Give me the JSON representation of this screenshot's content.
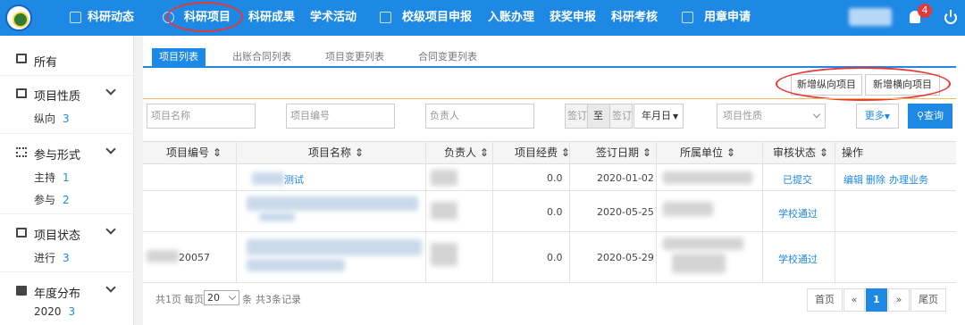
{
  "nav": {
    "items": [
      "科研动态",
      "科研项目",
      "科研成果",
      "学术活动",
      "校级项目申报",
      "入账办理",
      "获奖申报",
      "科研考核",
      "用章申请"
    ],
    "badge": "4"
  },
  "sidebar": {
    "all_label": "所有",
    "groups": [
      {
        "title": "项目性质",
        "items": [
          {
            "label": "纵向",
            "count": "3"
          }
        ]
      },
      {
        "title": "参与形式",
        "items": [
          {
            "label": "主持",
            "count": "1"
          },
          {
            "label": "参与",
            "count": "2"
          }
        ]
      },
      {
        "title": "项目状态",
        "items": [
          {
            "label": "进行",
            "count": "3"
          }
        ]
      },
      {
        "title": "年度分布",
        "items": [
          {
            "label": "2020",
            "count": "3"
          }
        ]
      }
    ]
  },
  "tabs": [
    "项目列表",
    "出账合同列表",
    "项目变更列表",
    "合同变更列表"
  ],
  "actions": {
    "new_vertical": "新增纵向项目",
    "new_horizontal": "新增横向项目"
  },
  "filters": {
    "project_name": "项目名称",
    "project_number": "项目编号",
    "owner": "负责人",
    "sign_label_1": "签订",
    "range_sep": "至",
    "sign_label_2": "签订",
    "date_unit": "年月日",
    "nature": "项目性质",
    "more": "更多",
    "query": "查询"
  },
  "table": {
    "headers": [
      "项目编号",
      "项目名称",
      "负责人",
      "项目经费",
      "签订日期",
      "所属单位",
      "审核状态",
      "操作"
    ],
    "rows": [
      {
        "number": "",
        "name": "测试",
        "funding": "0.0",
        "date": "2020-01-02",
        "status": "已提交",
        "ops": [
          "编辑",
          "删除",
          "办理业务"
        ]
      },
      {
        "number": "",
        "name": "",
        "funding": "0.0",
        "date": "2020-05-25",
        "status": "学校通过",
        "ops": []
      },
      {
        "number": "20057",
        "name": "",
        "funding": "0.0",
        "date": "2020-05-29",
        "status": "学校通过",
        "ops": []
      }
    ]
  },
  "pager": {
    "total_pages": "共1页",
    "per_page_label": "每页",
    "per_page_value": "20",
    "unit": "条",
    "total_records": "共3条记录",
    "first": "首页",
    "prev": "«",
    "current": "1",
    "next": "»",
    "last": "尾页"
  },
  "colors": {
    "accent": "#1e88e5",
    "highlight_ring": "#e53935",
    "divider": "#f5b85a"
  }
}
